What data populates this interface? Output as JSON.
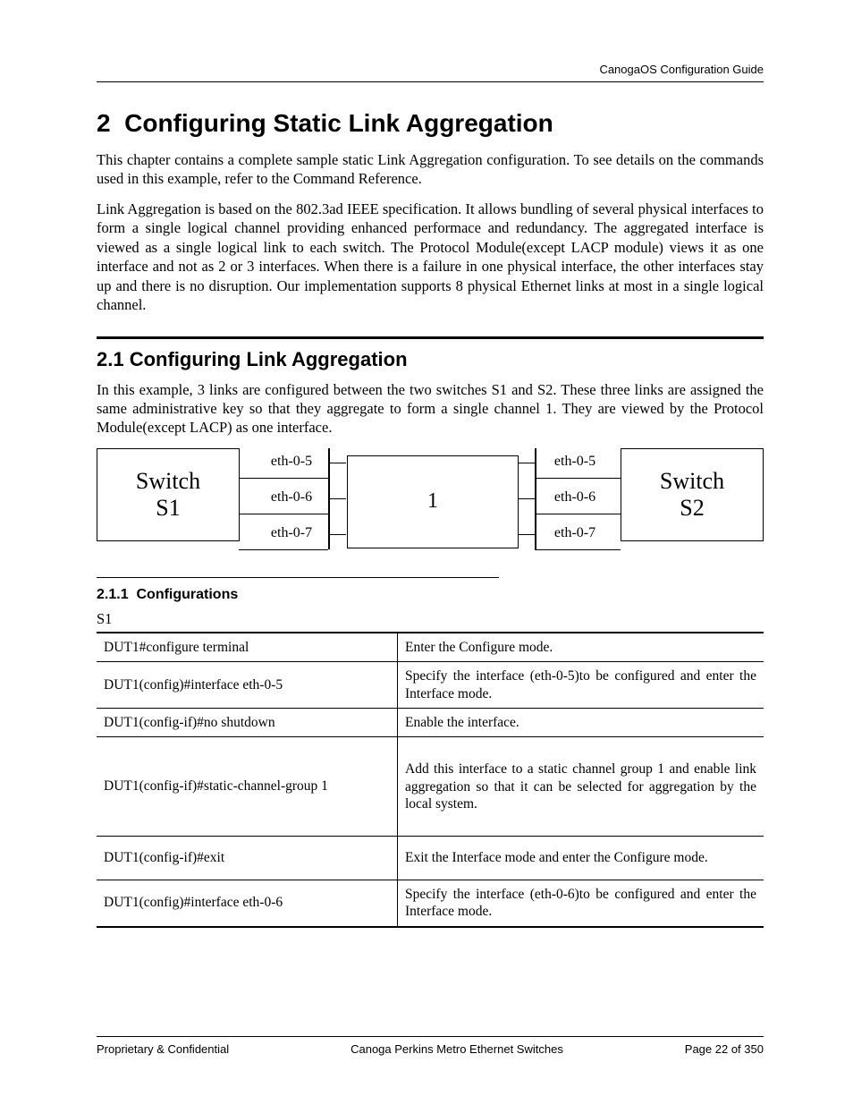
{
  "header": {
    "right": "CanogaOS Configuration Guide"
  },
  "chapter": {
    "number": "2",
    "title": "Configuring Static Link Aggregation"
  },
  "intro1": "This chapter contains a complete sample static Link Aggregation configuration. To see details on the commands used in this example, refer to the Command Reference.",
  "intro2": "Link Aggregation is based on the 802.3ad IEEE specification. It allows bundling of several physical interfaces to form a single logical channel providing enhanced performace and redundancy. The aggregated interface is viewed as a single logical link to each switch. The Protocol Module(except LACP module) views it as one interface and not as 2 or 3 interfaces. When there is a failure in one physical interface, the other interfaces stay up and there is no disruption. Our implementation supports 8 physical Ethernet links at most in a single logical channel.",
  "section": {
    "number": "2.1",
    "title": "Configuring Link Aggregation"
  },
  "section_body": "In this example, 3 links are configured between the two switches S1 and S2. These three links are assigned the same administrative key so that they aggregate to form a single channel 1. They are viewed by the Protocol Module(except LACP) as one interface.",
  "diagram": {
    "left_switch": {
      "line1": "Switch",
      "line2": "S1"
    },
    "right_switch": {
      "line1": "Switch",
      "line2": "S2"
    },
    "left_ports": [
      "eth-0-5",
      "eth-0-6",
      "eth-0-7"
    ],
    "right_ports": [
      "eth-0-5",
      "eth-0-6",
      "eth-0-7"
    ],
    "channel_label": "1"
  },
  "subsection": {
    "number": "2.1.1",
    "title": "Configurations"
  },
  "device_label": "S1",
  "table": {
    "rows": [
      {
        "cmd": "DUT1#configure terminal",
        "desc": "Enter the Configure mode."
      },
      {
        "cmd": "DUT1(config)#interface eth-0-5",
        "desc": "Specify the interface (eth-0-5)to be configured and enter the Interface mode."
      },
      {
        "cmd": "DUT1(config-if)#no shutdown",
        "desc": "Enable the interface."
      },
      {
        "cmd": "DUT1(config-if)#static-channel-group 1",
        "desc": "Add this interface to a static channel group 1 and enable link aggregation so that it can be selected for aggregation by the local system.",
        "tall": true
      },
      {
        "cmd": "DUT1(config-if)#exit",
        "desc": "Exit the Interface mode and enter the Configure mode."
      },
      {
        "cmd": "DUT1(config)#interface eth-0-6",
        "desc": "Specify the interface (eth-0-6)to be configured and enter the Interface mode."
      }
    ]
  },
  "footer": {
    "left": "Proprietary & Confidential",
    "center": "Canoga Perkins Metro Ethernet Switches",
    "right": "Page 22 of 350"
  }
}
